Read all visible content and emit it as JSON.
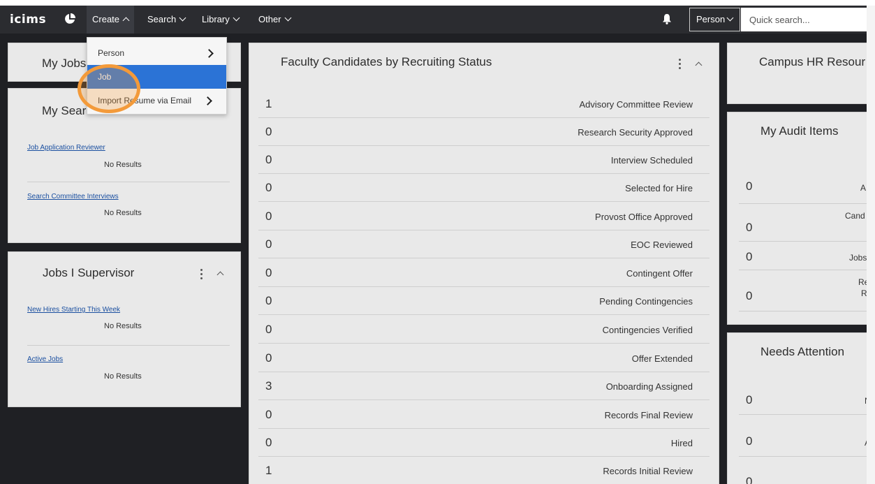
{
  "nav": {
    "logo": "icims",
    "menus": [
      {
        "label": "Create",
        "open": true
      },
      {
        "label": "Search"
      },
      {
        "label": "Library"
      },
      {
        "label": "Other"
      }
    ],
    "person_select": "Person",
    "quick_search_placeholder": "Quick search..."
  },
  "create_menu": {
    "items": [
      {
        "label": "Person",
        "has_submenu": true
      },
      {
        "label": "Job",
        "selected": true
      },
      {
        "label": "Import Resume via Email",
        "has_submenu": true
      }
    ]
  },
  "left": {
    "my_jobs": {
      "title": "My Jobs"
    },
    "my_searches": {
      "title": "My Searches",
      "items": [
        {
          "link": "Job Application Reviewer",
          "result": "No Results"
        },
        {
          "link": "Search Committee Interviews",
          "result": "No Results"
        }
      ]
    },
    "jobs_supervisor": {
      "title": "Jobs I Supervisor",
      "items": [
        {
          "link": "New Hires Starting This Week",
          "result": "No Results"
        },
        {
          "link": "Active Jobs",
          "result": "No Results"
        }
      ]
    }
  },
  "center": {
    "title": "Faculty Candidates by Recruiting Status",
    "rows": [
      {
        "count": "1",
        "status": "Advisory Committee Review"
      },
      {
        "count": "0",
        "status": "Research Security Approved"
      },
      {
        "count": "0",
        "status": "Interview Scheduled"
      },
      {
        "count": "0",
        "status": "Selected for Hire"
      },
      {
        "count": "0",
        "status": "Provost Office Approved"
      },
      {
        "count": "0",
        "status": "EOC Reviewed"
      },
      {
        "count": "0",
        "status": "Contingent Offer"
      },
      {
        "count": "0",
        "status": "Pending Contingencies"
      },
      {
        "count": "0",
        "status": "Contingencies Verified"
      },
      {
        "count": "0",
        "status": "Offer Extended"
      },
      {
        "count": "3",
        "status": "Onboarding Assigned"
      },
      {
        "count": "0",
        "status": "Records Final Review"
      },
      {
        "count": "0",
        "status": "Hired"
      },
      {
        "count": "1",
        "status": "Records Initial Review"
      }
    ]
  },
  "right": {
    "campus_hr": {
      "title": "Campus HR Resour"
    },
    "audit": {
      "title": "My Audit Items",
      "rows": [
        {
          "count": "0",
          "label": "A"
        },
        {
          "count": "0",
          "label": "Cand"
        },
        {
          "count": "0",
          "label": "Jobs"
        },
        {
          "count": "0",
          "label": "Re",
          "label2": "R"
        }
      ]
    },
    "needs_attention": {
      "title": "Needs Attention",
      "rows": [
        {
          "count": "0",
          "label": "N"
        },
        {
          "count": "0",
          "label": "A"
        },
        {
          "count": "0",
          "label": ""
        }
      ]
    }
  }
}
